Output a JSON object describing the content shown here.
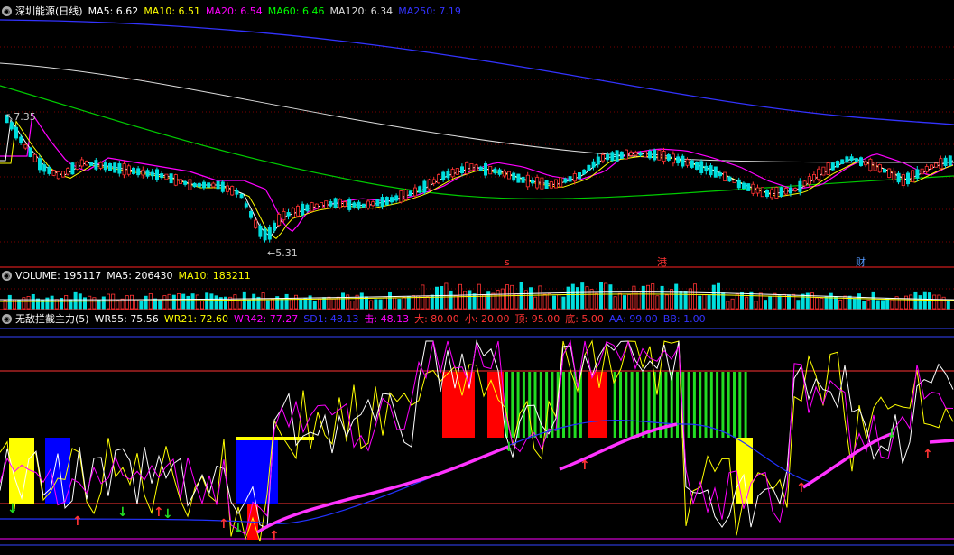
{
  "price_panel": {
    "title": "深圳能源(日线)",
    "indicators": [
      {
        "label": "MA5: 6.62",
        "color": "#ffffff"
      },
      {
        "label": "MA10: 6.51",
        "color": "#ffff00"
      },
      {
        "label": "MA20: 6.54",
        "color": "#ff00ff"
      },
      {
        "label": "MA60: 6.46",
        "color": "#00ff00"
      },
      {
        "label": "MA120: 6.34",
        "color": "#dddddd"
      },
      {
        "label": "MA250: 7.19",
        "color": "#3333ff"
      }
    ],
    "high_label": "7.35",
    "low_label": "5.31",
    "markers": {
      "s": "s",
      "gang": "港",
      "cai": "财"
    }
  },
  "volume_panel": {
    "indicators": [
      {
        "label": "VOLUME: 195117",
        "color": "#ffffff"
      },
      {
        "label": "MA5: 206430",
        "color": "#ffffff"
      },
      {
        "label": "MA10: 183211",
        "color": "#ffff00"
      }
    ]
  },
  "indicator_panel": {
    "title": "无敌拦截主力(5)",
    "indicators": [
      {
        "label": "WR55: 75.56",
        "color": "#ffffff"
      },
      {
        "label": "WR21: 72.60",
        "color": "#ffff00"
      },
      {
        "label": "WR42: 77.27",
        "color": "#ff00ff"
      },
      {
        "label": "SD1: 48.13",
        "color": "#3333ff"
      },
      {
        "label": "击: 48.13",
        "color": "#ff00ff"
      },
      {
        "label": "大: 80.00",
        "color": "#ff3333"
      },
      {
        "label": "小: 20.00",
        "color": "#ff3333"
      },
      {
        "label": "顶: 95.00",
        "color": "#ff3333"
      },
      {
        "label": "底: 5.00",
        "color": "#ff3333"
      },
      {
        "label": "AA: 99.00",
        "color": "#3333ff"
      },
      {
        "label": "BB: 1.00",
        "color": "#3333ff"
      }
    ]
  },
  "icons": {
    "panel_menu": "gear-circle-icon"
  }
}
